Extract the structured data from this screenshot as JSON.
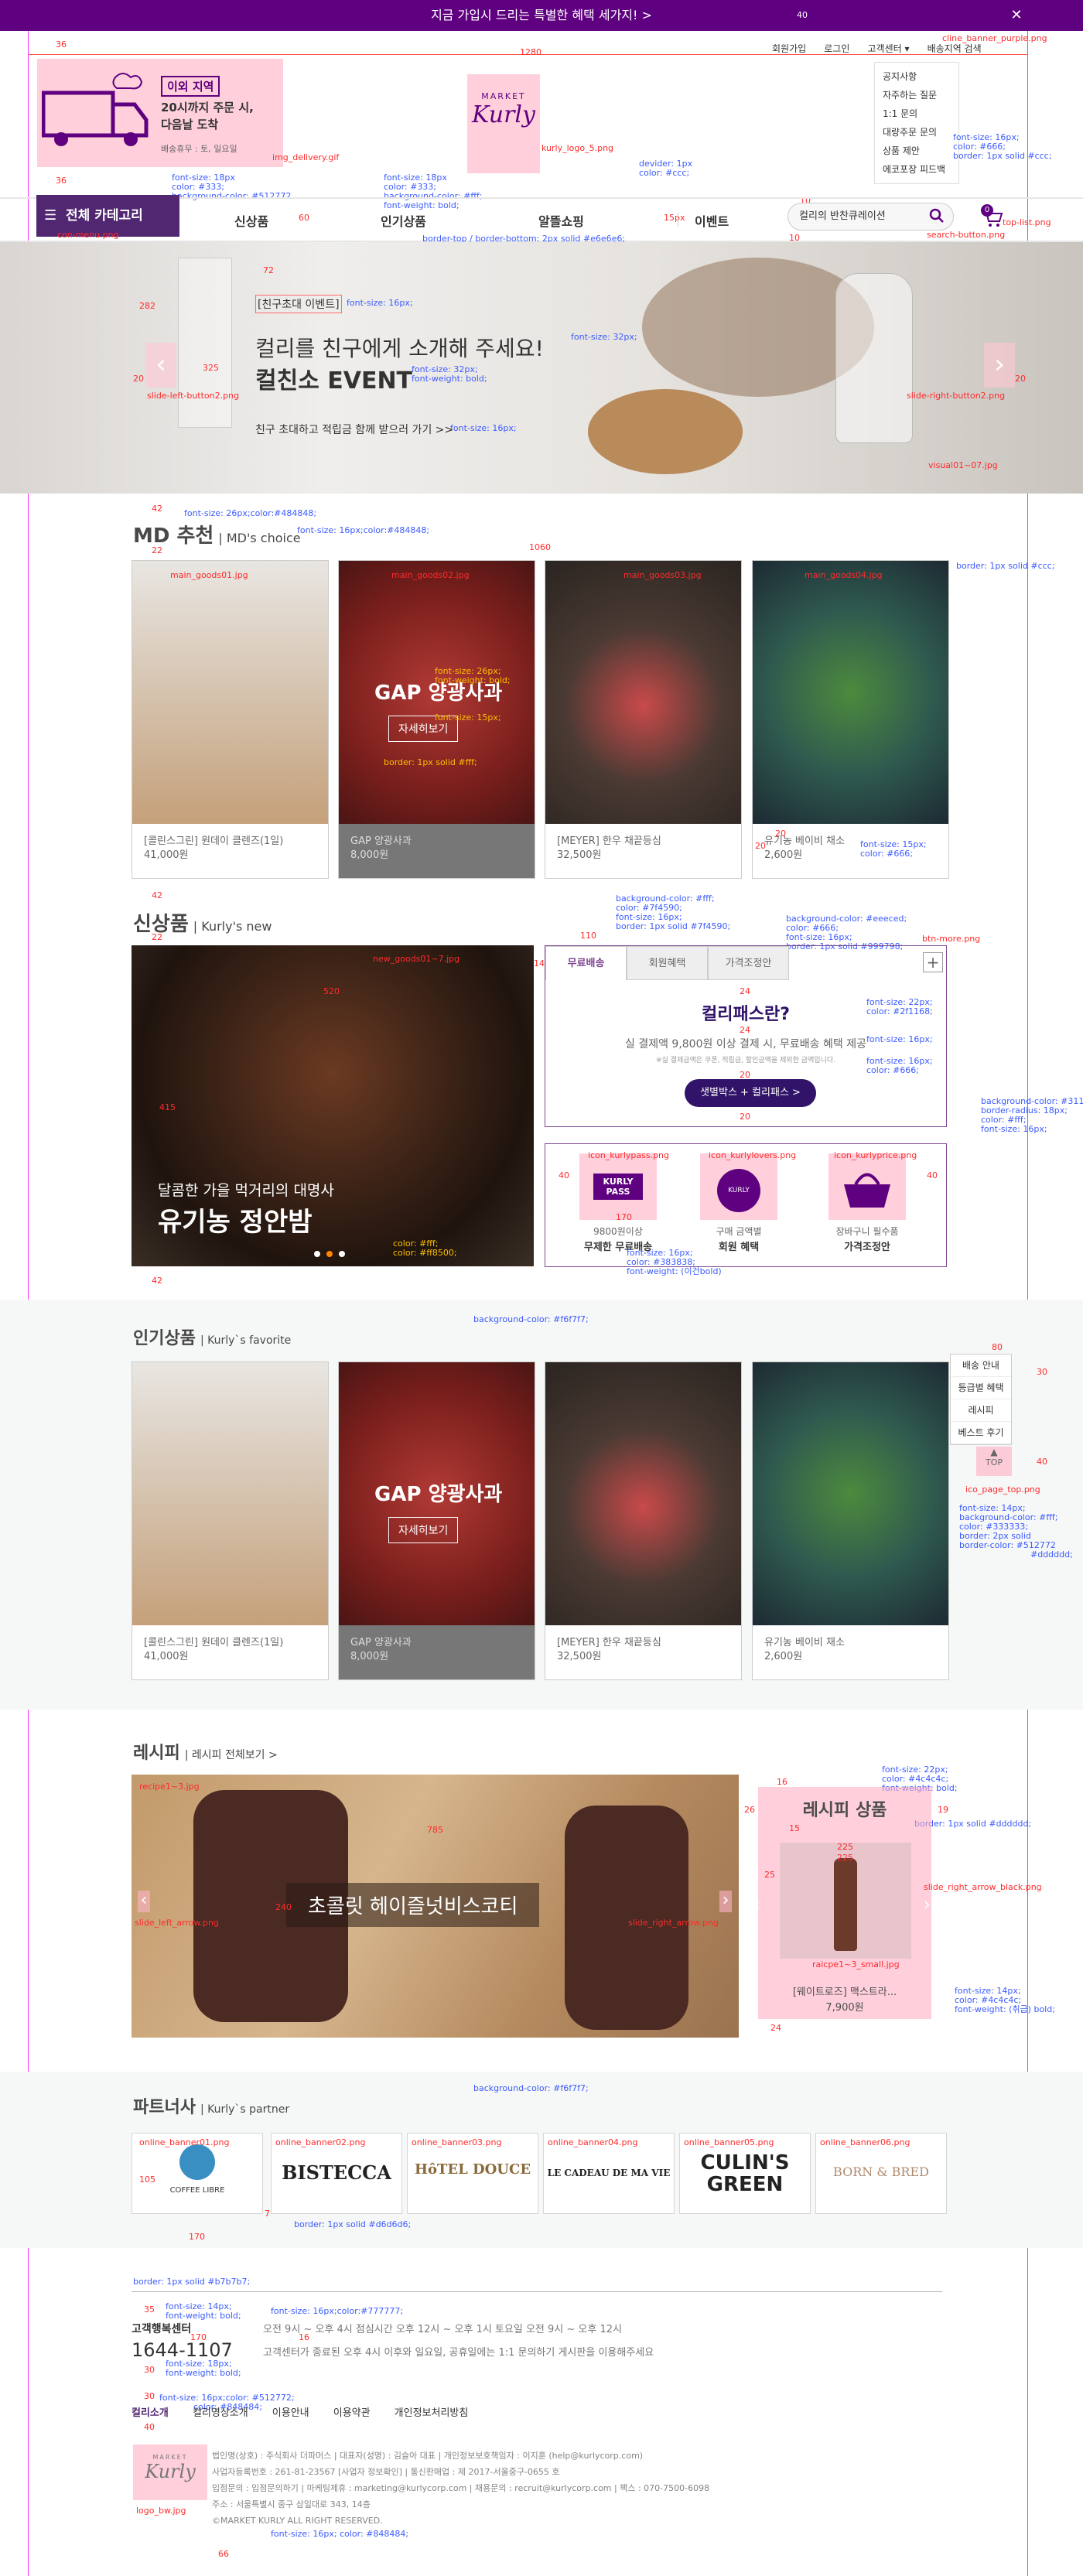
{
  "top_banner": {
    "text": "지금 가입시 드리는 특별한 혜택 세가지! >",
    "close": "✕"
  },
  "util": {
    "signup": "회원가입",
    "login": "로그인",
    "cs": "고객센터 ▾",
    "delivery": "배송지역 검색"
  },
  "cs_menu": [
    "공지사항",
    "자주하는 질문",
    "1:1 문의",
    "대량주문 문의",
    "상품 제안",
    "에코포장 피드백"
  ],
  "delivery_box": {
    "tag": "이외 지역",
    "line1": "20시까지 주문 시,",
    "line2": "다음날 도착",
    "sub": "배송휴무 : 토, 일요일"
  },
  "logo": {
    "top": "MARKET",
    "name": "Kurly"
  },
  "nav": {
    "category": "전체 카테고리",
    "items": [
      "신상품",
      "인기상품",
      "알뜰쇼핑",
      "이벤트"
    ],
    "search_placeholder": "컬리의 반찬큐레이션",
    "cart_count": "0"
  },
  "hero": {
    "label": "[친구초대 이벤트]",
    "title": "컬리를 친구에게 소개해 주세요!",
    "title2": "컬친소 EVENT",
    "sub": "친구 초대하고 적립금 함께 받으러 가기 >>"
  },
  "md": {
    "title": "MD 추천",
    "sub": "| MD's choice",
    "products": [
      {
        "name": "[콜린스그린] 원데이 클렌즈(1일)",
        "price": "41,000원"
      },
      {
        "name": "GAP 양광사과",
        "price": "8,000원",
        "overlay": "GAP 양광사과",
        "btn": "자세히보기"
      },
      {
        "name": "[MEYER] 한우 채끝등심",
        "price": "32,500원"
      },
      {
        "name": "유기농 베이비 채소",
        "price": "2,600원"
      }
    ]
  },
  "new": {
    "title": "신상품",
    "sub": "| Kurly's new",
    "feature_small": "달콤한 가을 먹거리의 대명사",
    "feature_big": "유기농 정안밤",
    "tabs": [
      "무료배송",
      "회원혜택",
      "가격조정안"
    ],
    "more": "+",
    "pass_title": "컬리패스란?",
    "pass_desc": "실 결제액 9,800원 이상 결제 시, 무료배송 혜택 제공",
    "pass_note": "※실 결제금액은 쿠폰, 적립금, 할인금액을 제외한 금액입니다.",
    "pass_btn": "샛별박스 + 컬리패스 >",
    "icons": [
      {
        "label": "KURLY PASS",
        "l1": "9800원이상",
        "l2": "무제한 무료배송"
      },
      {
        "label": "KURLY LOVERS",
        "l1": "구매 금액별",
        "l2": "회원 혜택"
      },
      {
        "label": "",
        "l1": "장바구니 필수품",
        "l2": "가격조정안"
      }
    ]
  },
  "popular": {
    "title": "인기상품",
    "sub": "| Kurly`s favorite",
    "products": [
      {
        "name": "[콜린스그린] 원데이 클렌즈(1일)",
        "price": "41,000원"
      },
      {
        "name": "GAP 양광사과",
        "price": "8,000원",
        "overlay": "GAP 양광사과",
        "btn": "자세히보기"
      },
      {
        "name": "[MEYER] 한우 채끝등심",
        "price": "32,500원"
      },
      {
        "name": "유기농 베이비 채소",
        "price": "2,600원"
      }
    ]
  },
  "quick": [
    "배송 안내",
    "등급별 혜택",
    "레시피",
    "베스트 후기"
  ],
  "top_btn": "TOP",
  "recipe": {
    "title": "레시피",
    "sub": "| 레시피 전체보기 >",
    "main": "초콜릿 헤이즐넛비스코티",
    "prod_title": "레시피 상품",
    "prod_name": "[웨이트로즈] 맥스트라...",
    "prod_price": "7,900원"
  },
  "partner": {
    "title": "파트너사",
    "sub": "| Kurly`s partner",
    "logos": [
      "COFFEE LIBRE",
      "BISTECCA",
      "HôTEL DOUCE",
      "LE CADEAU DE MA VIE",
      "CULIN'S GREEN",
      "BORN & BRED"
    ]
  },
  "footer": {
    "cs_label": "고객행복센터",
    "phone": "1644-1107",
    "hours1": "오전 9시 ~ 오후 4시 점심시간 오후 12시 ~ 오후 1시 토요일 오전 9시 ~ 오후 12시",
    "hours2": "고객센터가 종료된 오후 4시 이후와 일요일, 공휴일에는 1:1 문의하기 게시판을 이용해주세요",
    "links": [
      "컬리소개",
      "컬리영상소개",
      "이용안내",
      "이용약관",
      "개인정보처리방침"
    ],
    "info1": "법인명(상호) : 주식회사 더파머스 | 대표자(성명) : 김슬아 대표 | 개인정보보호책임자 : 이지훈 (help@kurlycorp.com)",
    "info2": "사업자등록번호 : 261-81-23567 [사업자 정보확인] | 통신판매업 : 제 2017-서울중구-0655 호",
    "info3": "입점문의 : 입점문의하기 | 마케팅제휴 : marketing@kurlycorp.com | 채용문의 : recruit@kurlycorp.com | 팩스 : 070-7500-6098",
    "info4": "주소 : 서울특별시 중구 삼일대로 343, 14층",
    "copy": "©MARKET KURLY ALL RIGHT RESERVED."
  },
  "annotations": {
    "a40": "40",
    "a36": "36",
    "a36b": "36",
    "a1280": "1280",
    "banner_img": "cline_banner_purple.png",
    "delivery_img": "img_delivery.gif",
    "util_font": "font-size: 16px;",
    "util_color": "color: #666;",
    "util_border": "border: 1px solid #ccc;",
    "logo_img": "kurly_logo_5.png",
    "f18a": "font-size: 18px",
    "c333a": "color: #333;",
    "bg512": "background-color: #512772",
    "f18b": "font-size: 18px",
    "c333b": "color: #333;",
    "bgfff": "background-color: #fff;",
    "fw": "font-weight: bold;",
    "divider": "devider: 1px",
    "dividerc": "color: #ccc;",
    "a15": "15px",
    "a10": "10",
    "a10b": "10",
    "a60": "60",
    "menu_img": "con-menu.png",
    "search_img": "search-button.png",
    "cart_img": "top-list.png",
    "nav_border": "border-top / border-bottom: 2px solid #e6e6e6;",
    "a72": "72",
    "a282": "282",
    "a325": "325",
    "a20": "20",
    "a20b": "20",
    "hero_f16": "font-size: 16px;",
    "hero_f32": "font-size: 32px;",
    "hero_f32b": "font-size: 32px;",
    "hero_fw": "font-weight: bold;",
    "hero_f16b": "font-size: 16px;",
    "slide_left": "slide-left-button2.png",
    "slide_right": "slide-right-button2.png",
    "visual": "visual01~07.jpg",
    "md_f26": "font-size: 26px;color:#484848;",
    "md_f16": "font-size: 16px;color:#484848;",
    "a42": "42",
    "a22": "22",
    "a1060": "1060",
    "md_border": "border: 1px solid #ccc;",
    "md_img1": "main_goods01.jpg",
    "md_img2": "main_goods02.jpg",
    "md_img3": "main_goods03.jpg",
    "md_img4": "main_goods04.jpg",
    "a15b": "15",
    "gap_f26": "font-size: 26px;",
    "gap_fw": "font-weight: bold;",
    "gap_f15": "font-size: 15px;",
    "gap_border": "border: 1px solid #fff;",
    "a20c": "20",
    "a20d": "20",
    "card_f15": "font-size: 15px;",
    "card_c666": "color: #666;",
    "a42b": "42",
    "a22b": "22",
    "new_img": "new_goods01~7.jpg",
    "a110": "110",
    "a14": "14",
    "tab1": "background-color: #fff;",
    "tab2": "color: #7f4590;",
    "tab3": "font-size: 16px;",
    "tab4": "border: 1px solid #7f4590;",
    "tabb1": "background-color: #eeeced;",
    "tabb2": "color: #666;",
    "tabb3": "font-size: 16px;",
    "tabb4": "border: 1px solid #999798;",
    "btn_more": "btn-more.png",
    "a24": "24",
    "a24b": "24",
    "p_f22": "font-size: 22px;",
    "p_c": "color: #2f1168;",
    "p_f16": "font-size: 16px;",
    "p_f16b": "font-size: 16px;",
    "p_c666": "color: #666;",
    "b1": "background-color: #311369;",
    "b2": "border-radius: 18px;",
    "b3": "color: #fff;",
    "b4": "font-size: 16px;",
    "a20e": "20",
    "a20f": "20",
    "a415": "415",
    "a520": "520",
    "a40b": "40",
    "a40c": "40",
    "a20g": "20",
    "a170": "170",
    "ic1": "icon_kurlypass.png",
    "ic2": "icon_kurlylovers.png",
    "ic3": "icon_kurlyprice.png",
    "ic_f": "font-size: 16px;",
    "ic_c": "color: #383838;",
    "ic_fw": "font-weight: (이건bold)",
    "dots_c": "color: #fff;",
    "dots_c2": "color: #ff8500;",
    "a10c": "10",
    "a10d": "10",
    "a10e": "10",
    "a14b": "14",
    "a42c": "42",
    "pop_bg": "background-color: #f6f7f7;",
    "a80": "80",
    "a20h": "20",
    "a30": "30",
    "a40d": "40",
    "top_img": "ico_page_top.png",
    "q1": "font-size: 14px;",
    "q2": "background-color: #fff;",
    "q3": "color: #333333;",
    "q4": "border: 2px solid",
    "q5": "border-color: #512772",
    "q6": "#dddddd;",
    "r16": "16",
    "r26": "26",
    "r19": "19",
    "r15": "15",
    "r225": "225",
    "r225b": "225",
    "r25": "25",
    "r785": "785",
    "r24": "24",
    "r240": "240",
    "recipe_img": "recipe1~3.jpg",
    "rs_left": "slide_left_arrow.png",
    "rs_right": "slide_right_arrow.png",
    "rs_black": "slide_right_arrow_black.png",
    "rf22": "font-size: 22px;",
    "rc": "color: #4c4c4c;",
    "rfw": "font-weight: bold;",
    "rborder": "border: 1px solid #dddddd;",
    "rsmall": "raicpe1~3_small.jpg",
    "rf14": "font-size: 14px;",
    "rc2": "color: #4c4c4c;",
    "rfw2": "font-weight: (취급) bold;",
    "p_bg": "background-color: #f6f7f7;",
    "pb1": "online_banner01.png",
    "pb2": "online_banner02.png",
    "pb3": "online_banner03.png",
    "pb4": "online_banner04.png",
    "pb5": "online_banner05.png",
    "pb6": "online_banner06.png",
    "a105": "105",
    "a7": "7",
    "a170b": "170",
    "pborder": "border: 1px solid #d6d6d6;",
    "fb": "border: 1px solid #b7b7b7;",
    "f35": "35",
    "f14": "font-size: 14px;",
    "ffw": "font-weight: bold;",
    "f16": "font-size: 16px;color:#777777;",
    "f16n": "16",
    "f170": "170",
    "f18": "font-size: 18px;",
    "ffw2": "font-weight: bold;",
    "f30": "30",
    "f30b": "30",
    "f40": "40",
    "fl1": "font-size: 16px;color: #512772;",
    "fl2": "color: #848484;",
    "flogo": "logo_bw.jpg",
    "f66": "66",
    "ff1": "font-size: 16px; color: #848484;"
  }
}
